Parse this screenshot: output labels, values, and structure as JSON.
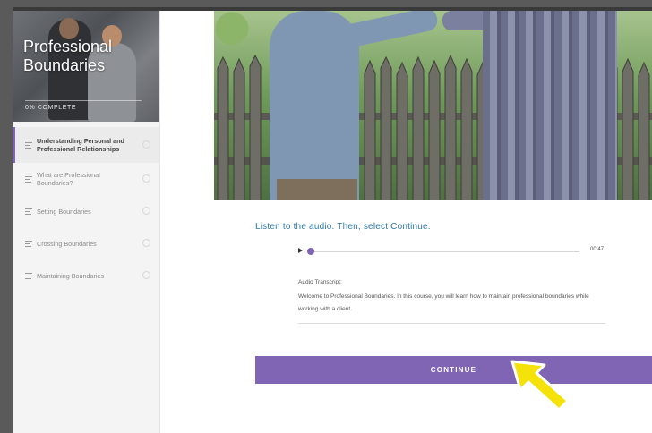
{
  "course": {
    "title_line1": "Professional",
    "title_line2": "Boundaries",
    "progress_label": "0% COMPLETE",
    "progress": 0
  },
  "lessons": [
    {
      "label": "Understanding Personal and Professional Relationships",
      "active": true
    },
    {
      "label": "What are Professional Boundaries?",
      "active": false
    },
    {
      "label": "Setting Boundaries",
      "active": false
    },
    {
      "label": "Crossing Boundaries",
      "active": false
    },
    {
      "label": "Maintaining Boundaries",
      "active": false
    }
  ],
  "main": {
    "instruction": "Listen to the audio. Then, select Continue.",
    "audio": {
      "time": "00:47",
      "position": 0
    },
    "transcript": {
      "label": "Audio Transcript:",
      "body": "Welcome to Professional Boundaries. In this course, you will learn how to maintain professional boundaries while working with a client."
    },
    "continue_label": "CONTINUE"
  },
  "colors": {
    "accent": "#8065b5",
    "instruction_text": "#2e78a8",
    "arrow": "#f5e20a"
  },
  "icons": [
    "lesson-lines-icon",
    "lesson-status-icon",
    "play-icon",
    "cursor-arrow-icon"
  ]
}
